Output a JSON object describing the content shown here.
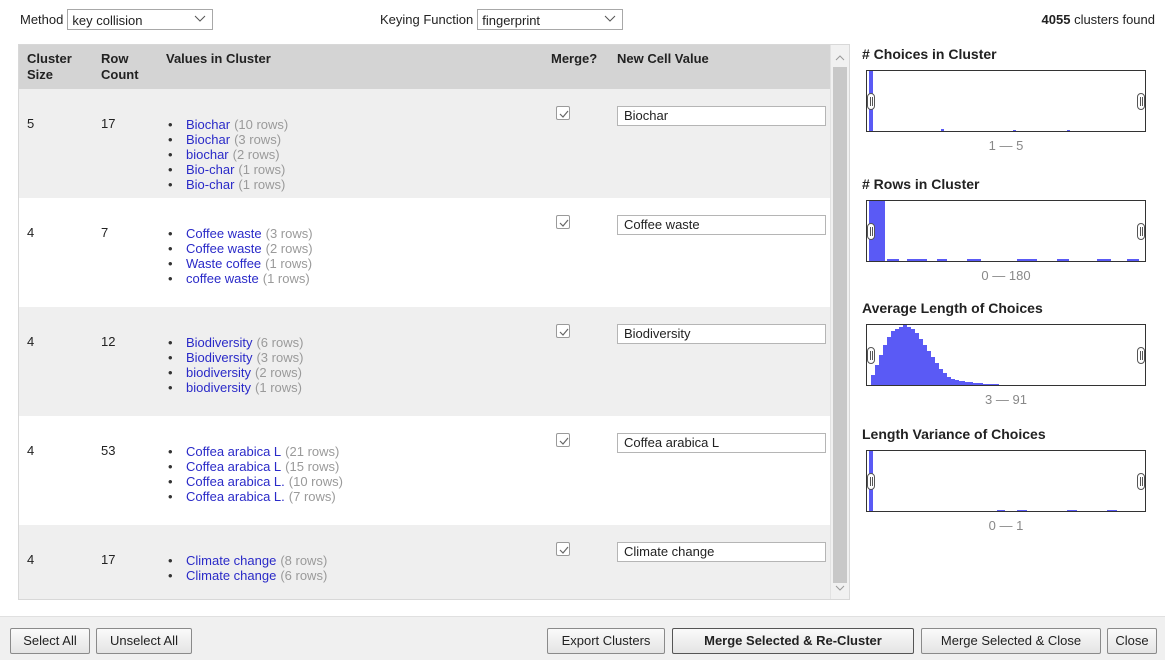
{
  "controls": {
    "method_label": "Method",
    "method_value": "key collision",
    "keying_label": "Keying Function",
    "keying_value": "fingerprint",
    "clusters_count": "4055",
    "clusters_suffix": "clusters found"
  },
  "table": {
    "headers": {
      "cluster_size": "Cluster Size",
      "row_count": "Row Count",
      "values": "Values in Cluster",
      "merge": "Merge?",
      "new_value": "New Cell Value"
    },
    "rows": [
      {
        "size": "5",
        "row_count": "17",
        "merge": true,
        "new_value": "Biochar",
        "values": [
          {
            "value": "Biochar",
            "count": "(10 rows)"
          },
          {
            "value": "Biochar",
            "count": "(3 rows)"
          },
          {
            "value": "biochar",
            "count": "(2 rows)"
          },
          {
            "value": "Bio-char",
            "count": "(1 rows)"
          },
          {
            "value": "Bio-char",
            "count": "(1 rows)"
          }
        ]
      },
      {
        "size": "4",
        "row_count": "7",
        "merge": true,
        "new_value": "Coffee waste",
        "values": [
          {
            "value": "Coffee waste",
            "count": "(3 rows)"
          },
          {
            "value": "Coffee waste",
            "count": "(2 rows)"
          },
          {
            "value": "Waste coffee",
            "count": "(1 rows)"
          },
          {
            "value": "coffee waste",
            "count": "(1 rows)"
          }
        ]
      },
      {
        "size": "4",
        "row_count": "12",
        "merge": true,
        "new_value": "Biodiversity",
        "values": [
          {
            "value": "Biodiversity",
            "count": "(6 rows)"
          },
          {
            "value": "Biodiversity",
            "count": "(3 rows)"
          },
          {
            "value": "biodiversity",
            "count": "(2 rows)"
          },
          {
            "value": "biodiversity",
            "count": "(1 rows)"
          }
        ]
      },
      {
        "size": "4",
        "row_count": "53",
        "merge": true,
        "new_value": "Coffea arabica L",
        "values": [
          {
            "value": "Coffea arabica L",
            "count": "(21 rows)"
          },
          {
            "value": "Coffea arabica L",
            "count": "(15 rows)"
          },
          {
            "value": "Coffea arabica L.",
            "count": "(10 rows)"
          },
          {
            "value": "Coffea arabica L.",
            "count": "(7 rows)"
          }
        ]
      },
      {
        "size": "4",
        "row_count": "17",
        "merge": true,
        "new_value": "Climate change",
        "values": [
          {
            "value": "Climate change",
            "count": "(8 rows)"
          },
          {
            "value": "Climate change",
            "count": "(6 rows)"
          }
        ]
      }
    ]
  },
  "facets": [
    {
      "title": "# Choices in Cluster",
      "range": "1 — 5"
    },
    {
      "title": "# Rows in Cluster",
      "range": "0 — 180"
    },
    {
      "title": "Average Length of Choices",
      "range": "3 — 91"
    },
    {
      "title": "Length Variance of Choices",
      "range": "0 — 1"
    }
  ],
  "buttons": {
    "select_all": "Select All",
    "unselect_all": "Unselect All",
    "export": "Export Clusters",
    "merge_recluster": "Merge Selected & Re-Cluster",
    "merge_close": "Merge Selected & Close",
    "close": "Close"
  },
  "colors": {
    "histogram": "#5a5af5",
    "link": "#2a2ac8",
    "header_bg": "#d4d4d4"
  }
}
